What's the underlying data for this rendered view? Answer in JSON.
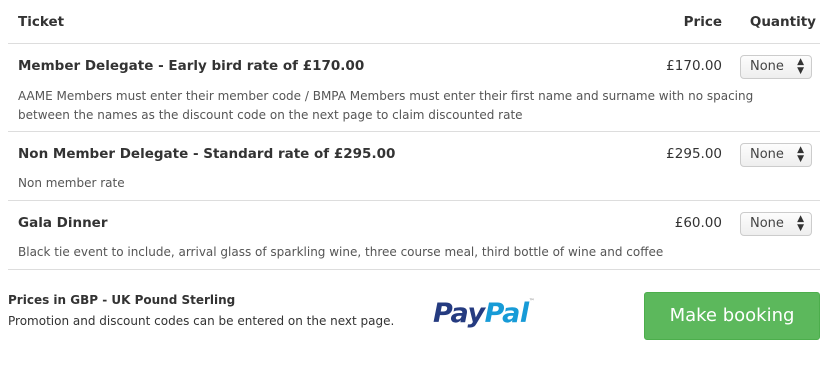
{
  "table": {
    "headers": {
      "ticket": "Ticket",
      "price": "Price",
      "quantity": "Quantity"
    },
    "tickets": [
      {
        "name": "Member Delegate - Early bird rate of £170.00",
        "price": "£170.00",
        "description": "AAME Members must enter their member code / BMPA Members must enter their first name and surname with no spacing between the names as the discount code on the next page to claim discounted rate",
        "quantity": "None"
      },
      {
        "name": "Non Member Delegate - Standard rate of £295.00",
        "price": "£295.00",
        "description": "Non member rate",
        "quantity": "None"
      },
      {
        "name": "Gala Dinner",
        "price": "£60.00",
        "description": "Black tie event to include, arrival glass of sparkling wine, three course meal, third bottle of wine and coffee",
        "quantity": "None"
      }
    ]
  },
  "footer": {
    "currency_note": "Prices in GBP - UK Pound Sterling",
    "promo_note": "Promotion and discount codes can be entered on the next page.",
    "paypal": {
      "pay": "Pay",
      "pal": "Pal",
      "tm": "™"
    },
    "book_button": "Make booking"
  },
  "colors": {
    "button_green": "#5cb85c",
    "paypal_dark_blue": "#253b80",
    "paypal_light_blue": "#179bd7"
  },
  "icons": {
    "select_arrows": "up-down-chevron-icon"
  }
}
